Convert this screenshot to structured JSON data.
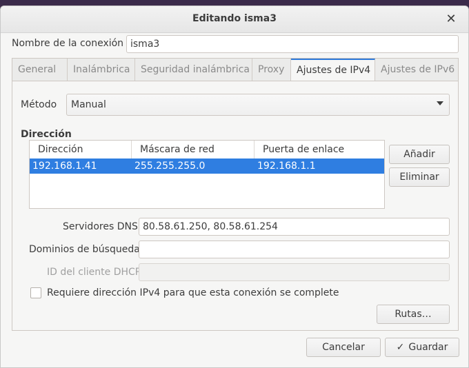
{
  "window": {
    "title": "Editando isma3"
  },
  "connection": {
    "name_label": "Nombre de la conexión",
    "name_value": "isma3"
  },
  "tabs": [
    {
      "label": "General"
    },
    {
      "label": "Inalámbrica"
    },
    {
      "label": "Seguridad inalámbrica"
    },
    {
      "label": "Proxy"
    },
    {
      "label": "Ajustes de IPv4"
    },
    {
      "label": "Ajustes de IPv6"
    }
  ],
  "ipv4": {
    "method_label": "Método",
    "method_value": "Manual",
    "section_title": "Dirección",
    "columns": [
      "Dirección",
      "Máscara de red",
      "Puerta de enlace"
    ],
    "rows": [
      {
        "address": "192.168.1.41",
        "netmask": "255.255.255.0",
        "gateway": "192.168.1.1"
      }
    ],
    "add_label": "Añadir",
    "remove_label": "Eliminar",
    "dns_label": "Servidores DNS",
    "dns_value": "80.58.61.250, 80.58.61.254",
    "search_label": "Dominios de búsqueda",
    "search_value": "",
    "dhcp_label": "ID del cliente DHCP",
    "dhcp_value": "",
    "require_label": "Requiere dirección IPv4 para que esta conexión se complete",
    "routes_label": "Rutas…"
  },
  "footer": {
    "cancel_label": "Cancelar",
    "save_label": "Guardar"
  }
}
